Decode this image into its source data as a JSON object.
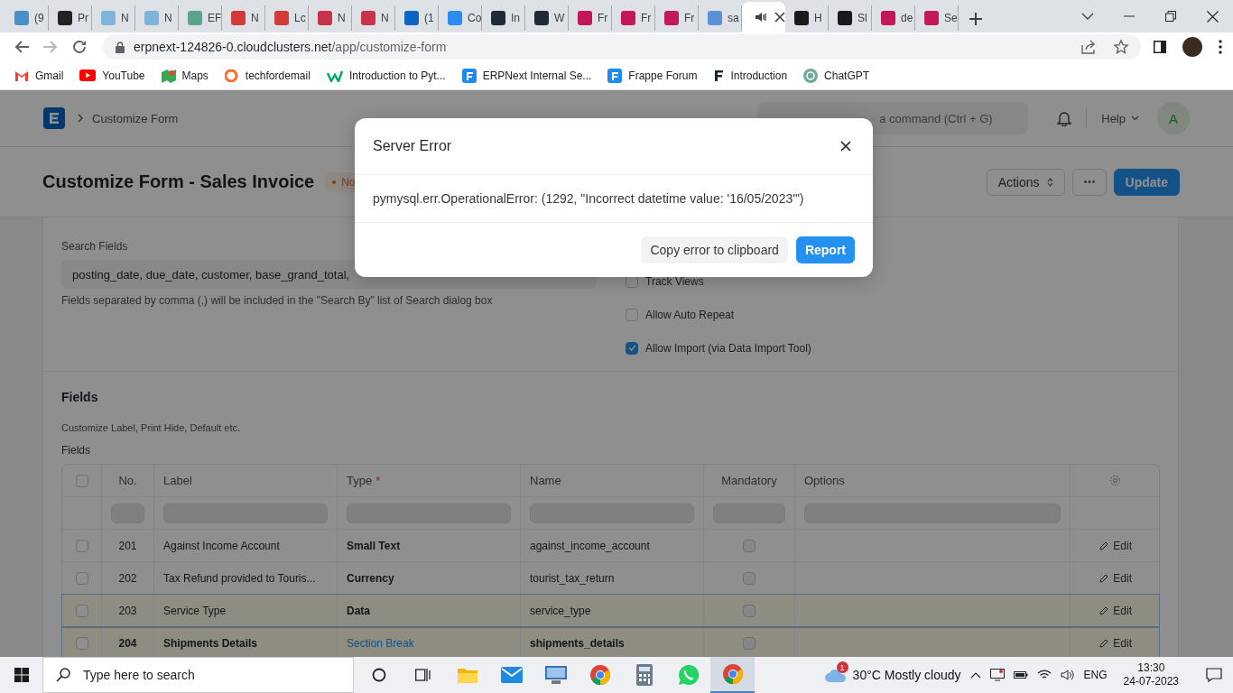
{
  "browser": {
    "tabs": [
      {
        "title": "(9",
        "color": "#4a90c8",
        "kind": "page",
        "selected": false
      },
      {
        "title": "Pr",
        "color": "#222222",
        "kind": "page",
        "selected": false
      },
      {
        "title": "N",
        "color": "#7fb4d9",
        "kind": "page",
        "selected": false
      },
      {
        "title": "N",
        "color": "#7fb4d9",
        "kind": "page",
        "selected": false
      },
      {
        "title": "EF",
        "color": "#5aa48c",
        "kind": "page",
        "selected": false
      },
      {
        "title": "N",
        "color": "#d33a3a",
        "kind": "page",
        "selected": false
      },
      {
        "title": "Lc",
        "color": "#d33a3a",
        "kind": "page",
        "selected": false
      },
      {
        "title": "N",
        "color": "#c8324a",
        "kind": "page",
        "selected": false
      },
      {
        "title": "N",
        "color": "#c8324a",
        "kind": "page",
        "selected": false
      },
      {
        "title": "(1",
        "color": "#0a66c2",
        "kind": "page",
        "selected": false
      },
      {
        "title": "Co",
        "color": "#2d8cf0",
        "kind": "page",
        "selected": false
      },
      {
        "title": "In",
        "color": "#1f2937",
        "kind": "page",
        "selected": false
      },
      {
        "title": "W",
        "color": "#1f2937",
        "kind": "page",
        "selected": false
      },
      {
        "title": "Fr",
        "color": "#c2185b",
        "kind": "page",
        "selected": false
      },
      {
        "title": "Fr",
        "color": "#c2185b",
        "kind": "page",
        "selected": false
      },
      {
        "title": "Fr",
        "color": "#c2185b",
        "kind": "page",
        "selected": false
      },
      {
        "title": "sa",
        "color": "#5b8fd6",
        "kind": "page",
        "selected": false
      },
      {
        "kind": "audio",
        "selected": true
      },
      {
        "title": "H",
        "color": "#1a1a1a",
        "kind": "page",
        "selected": false
      },
      {
        "title": "Sl",
        "color": "#1a1a1a",
        "kind": "page",
        "selected": false
      },
      {
        "title": "de",
        "color": "#c2185b",
        "kind": "page",
        "selected": false
      },
      {
        "title": "Se",
        "color": "#c2185b",
        "kind": "page",
        "selected": false
      }
    ],
    "address": {
      "host": "erpnext-124826-0.cloudclusters.net",
      "path": "/app/customize-form"
    },
    "bookmarks": [
      {
        "label": "Gmail",
        "kind": "gmail"
      },
      {
        "label": "YouTube",
        "kind": "youtube"
      },
      {
        "label": "Maps",
        "kind": "maps"
      },
      {
        "label": "techfordemail",
        "kind": "cpanel"
      },
      {
        "label": "Introduction to Pyt...",
        "kind": "w3"
      },
      {
        "label": "ERPNext Internal Se...",
        "kind": "frappe"
      },
      {
        "label": "Frappe Forum",
        "kind": "frappe"
      },
      {
        "label": "Introduction",
        "kind": "frappe_dark"
      },
      {
        "label": "ChatGPT",
        "kind": "chatgpt"
      }
    ]
  },
  "navbar": {
    "breadcrumb": "Customize Form",
    "search_placeholder": "a command (Ctrl + G)",
    "help": "Help",
    "avatar": "A"
  },
  "page_head": {
    "title": "Customize Form - Sales Invoice",
    "indicator": "No",
    "actions": "Actions",
    "primary": "Update"
  },
  "form": {
    "search_fields": {
      "label": "Search Fields",
      "value": "posting_date, due_date, customer, base_grand_total,",
      "help": "Fields separated by comma (,) will be included in the \"Search By\" list of Search dialog box"
    },
    "options": [
      {
        "label": "Track Views",
        "checked": false
      },
      {
        "label": "Allow Auto Repeat",
        "checked": false
      },
      {
        "label": "Allow Import (via Data Import Tool)",
        "checked": true
      }
    ]
  },
  "fields_section": {
    "title": "Fields",
    "description": "Customize Label, Print Hide, Default etc.",
    "table_label": "Fields",
    "select_all": {
      "checked": false
    },
    "columns": [
      {
        "label": "No."
      },
      {
        "label": "Label"
      },
      {
        "label": "Type",
        "required_mark": "*"
      },
      {
        "label": "Name"
      },
      {
        "label": "Mandatory"
      },
      {
        "label": "Options"
      }
    ],
    "rows": [
      {
        "checked": false,
        "no": "201",
        "label": "Against Income Account",
        "type": "Small Text",
        "name": "against_income_account",
        "mandatory": false,
        "kind": "field",
        "highlighted": false,
        "action": "Edit"
      },
      {
        "checked": false,
        "no": "202",
        "label": "Tax Refund provided to Touris...",
        "type": "Currency",
        "name": "tourist_tax_return",
        "mandatory": false,
        "kind": "field",
        "highlighted": false,
        "action": "Edit"
      },
      {
        "checked": false,
        "no": "203",
        "label": "Service Type",
        "type": "Data",
        "name": "service_type",
        "mandatory": false,
        "kind": "field",
        "highlighted": true,
        "action": "Edit"
      },
      {
        "checked": false,
        "no": "204",
        "label": "Shipments Details",
        "type": "Section Break",
        "name": "shipments_details",
        "mandatory": false,
        "kind": "section_break",
        "highlighted": true,
        "action": "Edit"
      }
    ]
  },
  "dialog": {
    "title": "Server Error",
    "message": "pymysql.err.OperationalError: (1292, \"Incorrect datetime value: '16/05/2023'\")",
    "buttons": [
      {
        "label": "Copy error to clipboard",
        "kind": "secondary"
      },
      {
        "label": "Report",
        "kind": "primary"
      }
    ]
  },
  "taskbar": {
    "search_placeholder": "Type here to search",
    "apps": [
      {
        "kind": "explorer",
        "selected": false
      },
      {
        "kind": "mail",
        "selected": false
      },
      {
        "kind": "remote",
        "selected": false
      },
      {
        "kind": "chrome",
        "selected": false
      },
      {
        "kind": "calculator",
        "selected": false
      },
      {
        "kind": "whatsapp",
        "selected": false
      },
      {
        "kind": "chrome",
        "selected": true
      }
    ],
    "weather": {
      "badge": "1",
      "temperature": "30°C",
      "condition": "Mostly cloudy"
    },
    "language": "ENG",
    "time": "13:30",
    "date": "24-07-2023"
  }
}
